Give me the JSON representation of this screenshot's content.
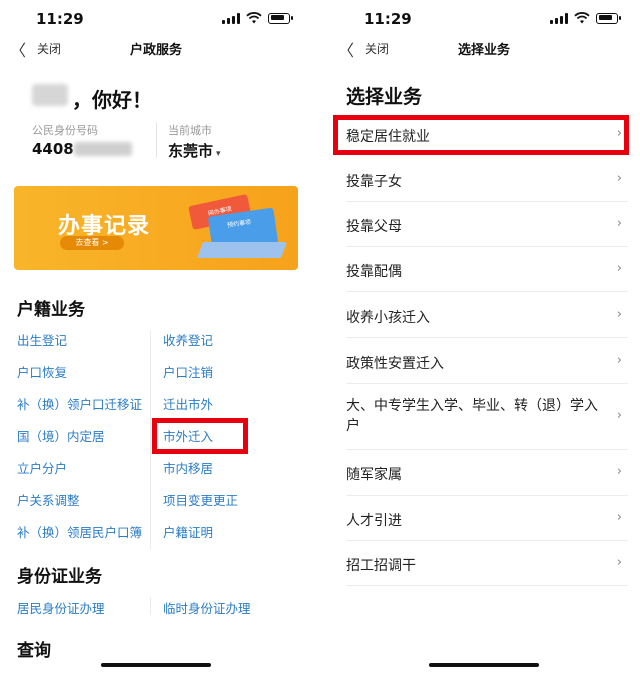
{
  "status_time": "11:29",
  "left": {
    "nav_close": "关闭",
    "nav_title": "户政服务",
    "greeting": "，你好！",
    "id_label": "公民身份号码",
    "id_value": "4408",
    "city_label": "当前城市",
    "city_value": "东莞市",
    "banner": {
      "title": "办事记录",
      "button": "去查看 >",
      "card1": "网办事项",
      "card2": "预约事项"
    },
    "sections": [
      {
        "title": "户籍业务",
        "items": [
          [
            "出生登记",
            "收养登记"
          ],
          [
            "户口恢复",
            "户口注销"
          ],
          [
            "补（换）领户口迁移证",
            "迁出市外"
          ],
          [
            "国（境）内定居",
            "市外迁入"
          ],
          [
            "立户分户",
            "市内移居"
          ],
          [
            "户关系调整",
            "项目变更更正"
          ],
          [
            "补（换）领居民户口簿",
            "户籍证明"
          ]
        ]
      },
      {
        "title": "身份证业务",
        "items": [
          [
            "居民身份证办理",
            "临时身份证办理"
          ]
        ]
      },
      {
        "title": "查询",
        "items": []
      }
    ]
  },
  "right": {
    "nav_close": "关闭",
    "nav_title": "选择业务",
    "heading": "选择业务",
    "options": [
      "稳定居住就业",
      "投靠子女",
      "投靠父母",
      "投靠配偶",
      "收养小孩迁入",
      "政策性安置迁入",
      "大、中专学生入学、毕业、转（退）学入户",
      "随军家属",
      "人才引进",
      "招工招调干"
    ]
  }
}
